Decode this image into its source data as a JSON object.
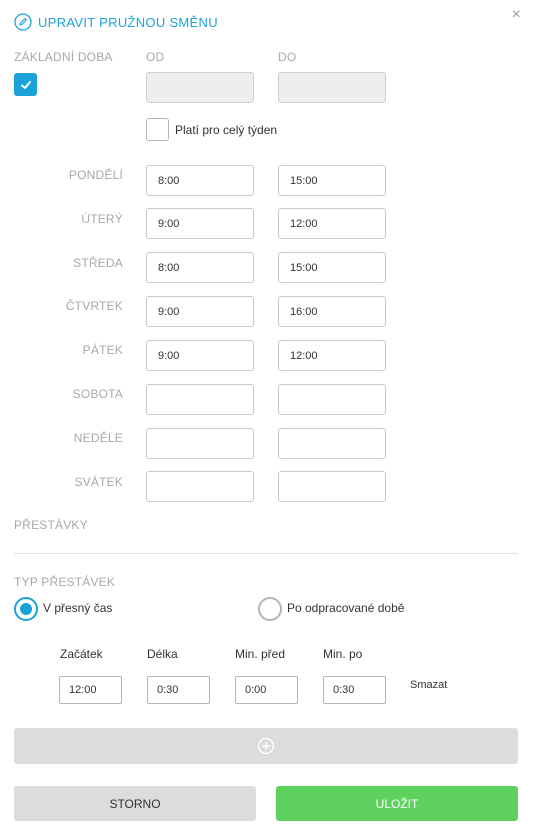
{
  "header": {
    "title": "UPRAVIT PRUŽNOU SMĚNU",
    "close": "×"
  },
  "colors": {
    "accent": "#1aa3d9",
    "save": "#5ed15e",
    "neutral_button": "#dcdcdc"
  },
  "base_time": {
    "label": "ZÁKLADNÍ DOBA",
    "checked": true,
    "from_label": "OD",
    "to_label": "DO",
    "from_value": "",
    "to_value": ""
  },
  "whole_week": {
    "label": "Platí pro celý týden",
    "checked": false
  },
  "days": [
    {
      "label": "PONDĚLÍ",
      "from": "8:00",
      "to": "15:00"
    },
    {
      "label": "ÚTERÝ",
      "from": "9:00",
      "to": "12:00"
    },
    {
      "label": "STŘEDA",
      "from": "8:00",
      "to": "15:00"
    },
    {
      "label": "ČTVRTEK",
      "from": "9:00",
      "to": "16:00"
    },
    {
      "label": "PÁTEK",
      "from": "9:00",
      "to": "12:00"
    },
    {
      "label": "SOBOTA",
      "from": "",
      "to": ""
    },
    {
      "label": "NEDĚLE",
      "from": "",
      "to": ""
    },
    {
      "label": "SVÁTEK",
      "from": "",
      "to": ""
    }
  ],
  "breaks": {
    "section_label": "PŘESTÁVKY",
    "type_label": "TYP PŘESTÁVEK",
    "options": [
      {
        "label": "V přesný čas",
        "selected": true
      },
      {
        "label": "Po odpracované době",
        "selected": false
      }
    ],
    "columns": {
      "start": "Začátek",
      "length": "Délka",
      "min_before": "Min. před",
      "min_after": "Min. po"
    },
    "row": {
      "start": "12:00",
      "length": "0:30",
      "min_before": "0:00",
      "min_after": "0:30",
      "delete_label": "Smazat"
    }
  },
  "footer": {
    "cancel_label": "STORNO",
    "save_label": "ULOŽIT"
  }
}
